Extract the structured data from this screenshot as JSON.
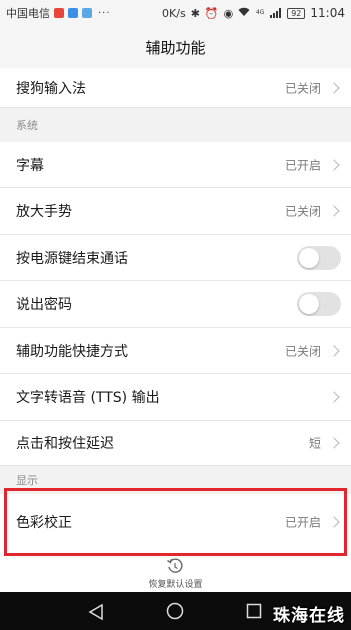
{
  "status_bar": {
    "carrier": "中国电信",
    "dots": "···",
    "speed": "0K/s",
    "battery": "92",
    "time": "11:04",
    "net_type": "4G",
    "icons": [
      "bluetooth-icon",
      "alarm-icon",
      "eye-icon",
      "wifi-icon",
      "signal-icon"
    ],
    "app_icon_colors": [
      "#e8453c",
      "#3a8ee6",
      "#5aa9e6"
    ]
  },
  "header": {
    "title": "辅助功能"
  },
  "rows": {
    "sogou": {
      "label": "搜狗输入法",
      "value": "已关闭"
    },
    "section_system": "系统",
    "subtitles": {
      "label": "字幕",
      "value": "已开启"
    },
    "magnify": {
      "label": "放大手势",
      "value": "已关闭"
    },
    "power_end_call": {
      "label": "按电源键结束通话",
      "toggle": false
    },
    "speak_password": {
      "label": "说出密码",
      "toggle": false
    },
    "shortcut": {
      "label": "辅助功能快捷方式",
      "value": "已关闭"
    },
    "tts": {
      "label": "文字转语音 (TTS) 输出"
    },
    "touch_delay": {
      "label": "点击和按住延迟",
      "value": "短"
    },
    "section_display": "显示",
    "color_correction": {
      "label": "色彩校正",
      "value": "已开启"
    }
  },
  "footer": {
    "restore_label": "恢复默认设置"
  },
  "watermark": "珠海在线",
  "colors": {
    "highlight": "#e3262d",
    "background": "#ffffff",
    "section_bg": "#f2f2f2"
  }
}
